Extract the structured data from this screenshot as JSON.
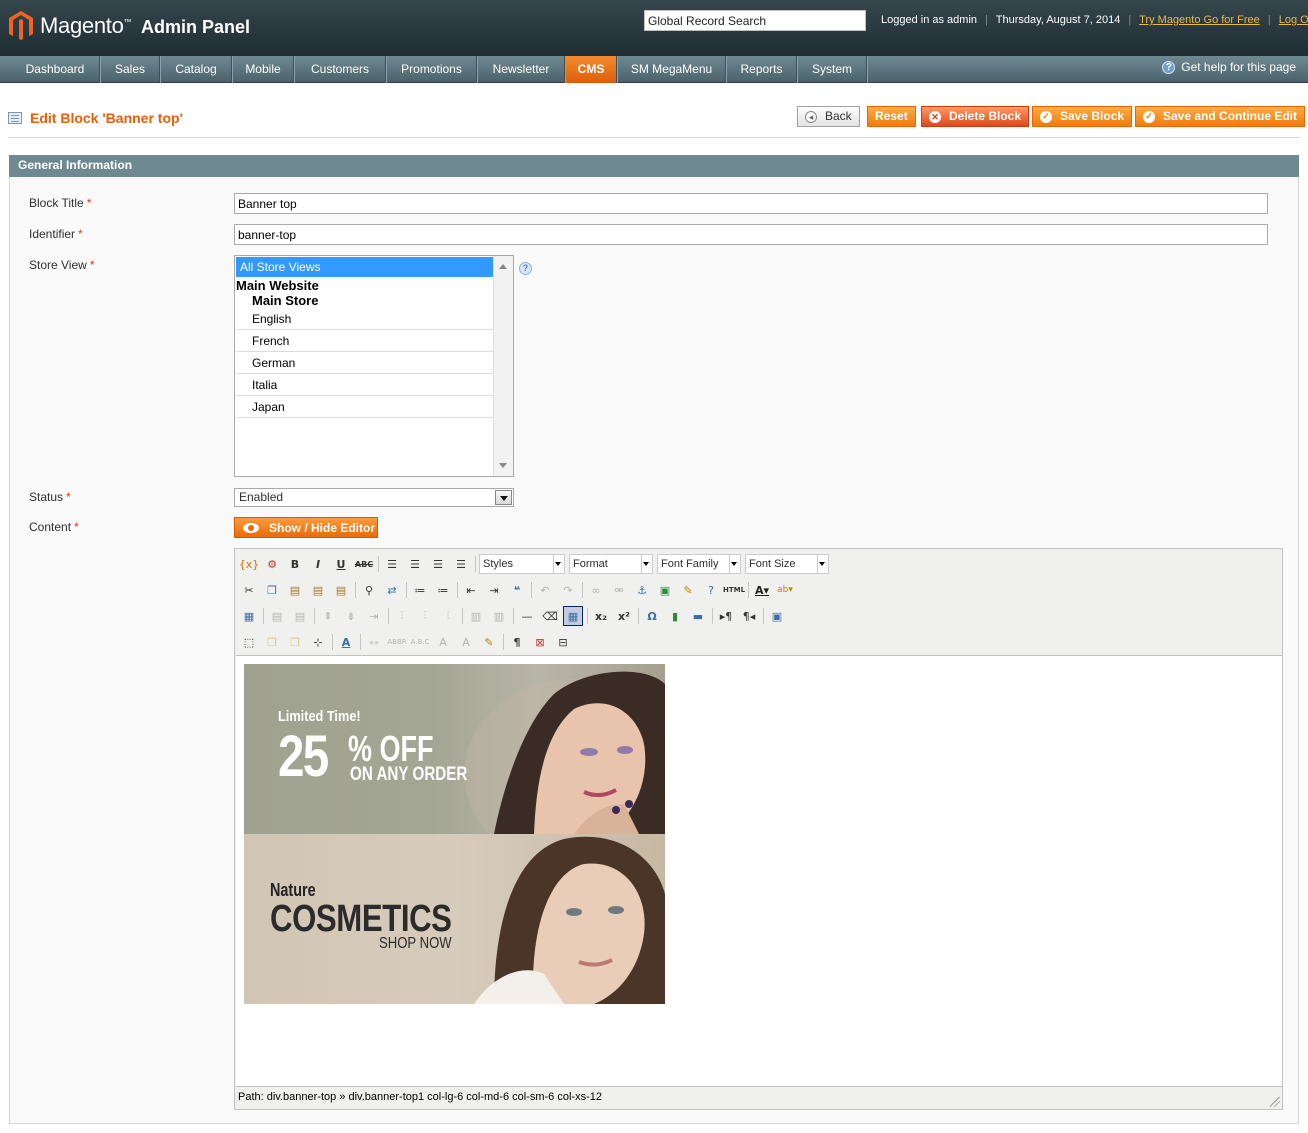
{
  "header": {
    "logo": "Magento",
    "logo_tm": "™",
    "logo_sub": "Admin Panel",
    "search_value": "Global Record Search",
    "logged_in": "Logged in as admin",
    "date": "Thursday, August 7, 2014",
    "try_link": "Try Magento Go for Free",
    "logout": "Log Out",
    "separator": "|"
  },
  "nav": {
    "items": [
      "Dashboard",
      "Sales",
      "Catalog",
      "Mobile",
      "Customers",
      "Promotions",
      "Newsletter",
      "CMS",
      "SM MegaMenu",
      "Reports",
      "System"
    ],
    "active": "CMS",
    "help": "Get help for this page"
  },
  "page": {
    "title": "Edit Block 'Banner top'",
    "buttons": {
      "back": "Back",
      "reset": "Reset",
      "delete": "Delete Block",
      "save": "Save Block",
      "save_continue": "Save and Continue Edit"
    }
  },
  "form": {
    "section_title": "General Information",
    "block_title_label": "Block Title",
    "block_title_value": "Banner top",
    "identifier_label": "Identifier",
    "identifier_value": "banner-top",
    "store_view_label": "Store View",
    "store_view_options": {
      "all": "All Store Views",
      "website": "Main Website",
      "store": "Main Store",
      "views": [
        "English",
        "French",
        "German",
        "Italia",
        "Japan"
      ]
    },
    "status_label": "Status",
    "status_value": "Enabled",
    "content_label": "Content",
    "required_mark": "*",
    "show_hide_editor": "Show / Hide Editor"
  },
  "editor": {
    "selects": [
      "Styles",
      "Format",
      "Font Family",
      "Font Size"
    ],
    "path": "Path: div.banner-top » div.banner-top1 col-lg-6 col-md-6 col-sm-6 col-xs-12"
  },
  "banners": {
    "banner1": {
      "limited": "Limited Time!",
      "pct": "25",
      "off": "% OFF",
      "any": "ON ANY ORDER"
    },
    "banner2": {
      "nature": "Nature",
      "cosmetics": "COSMETICS",
      "shop": "SHOP NOW"
    }
  },
  "colors": {
    "accent": "#eb5e00",
    "nav_bg": "#6f8992",
    "header_bg": "#1f2d33"
  }
}
